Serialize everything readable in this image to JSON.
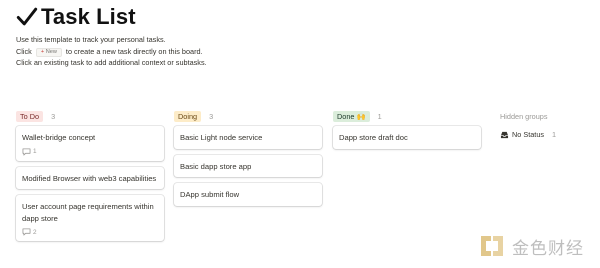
{
  "page": {
    "title": "Task List",
    "desc_line1": "Use this template to track your personal tasks.",
    "desc_line2_prefix": "Click",
    "new_chip_plus": "+",
    "new_chip_label": "New",
    "desc_line2_suffix": "to create a new task directly on this board.",
    "desc_line3": "Click an existing task to add additional context or subtasks."
  },
  "columns": [
    {
      "label": "To Do",
      "count": "3",
      "pill_bg": "#fbe4e2",
      "pill_color": "#7a2b2b",
      "cards": [
        {
          "title": "Wallet-bridge concept",
          "comments": "1"
        },
        {
          "title": "Modified Browser with web3 capabilities",
          "comments": ""
        },
        {
          "title": "User account page requirements within dapp store",
          "comments": "2"
        }
      ]
    },
    {
      "label": "Doing",
      "count": "3",
      "pill_bg": "#fdecc8",
      "pill_color": "#6b4a16",
      "cards": [
        {
          "title": "Basic Light node service",
          "comments": ""
        },
        {
          "title": "Basic dapp store app",
          "comments": ""
        },
        {
          "title": "DApp submit flow",
          "comments": ""
        }
      ]
    },
    {
      "label": "Done 🙌",
      "count": "1",
      "pill_bg": "#dbeddb",
      "pill_color": "#1c3829",
      "cards": [
        {
          "title": "Dapp store draft doc",
          "comments": ""
        }
      ]
    }
  ],
  "hidden_groups": {
    "label": "Hidden groups",
    "item_label": "No Status",
    "item_count": "1",
    "icon": "inbox-icon"
  },
  "watermark": {
    "text": "金色财经"
  }
}
